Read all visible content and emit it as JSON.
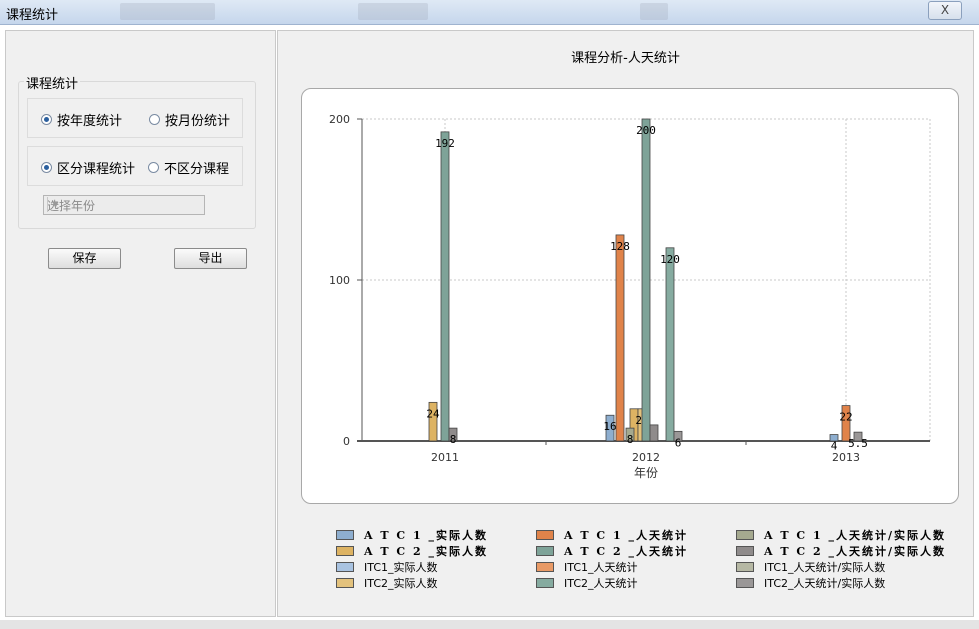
{
  "window": {
    "title": "课程统计",
    "close_label": "X"
  },
  "left": {
    "group_title": "课程统计",
    "radio_row1": [
      {
        "label": "按年度统计",
        "checked": true
      },
      {
        "label": "按月份统计",
        "checked": false
      }
    ],
    "radio_row2": [
      {
        "label": "区分课程统计",
        "checked": true
      },
      {
        "label": "不区分课程",
        "checked": false
      }
    ],
    "year_select": {
      "value": "选择年份"
    },
    "save_label": "保存",
    "export_label": "导出"
  },
  "chart_data": {
    "type": "bar",
    "title": "课程分析-人天统计",
    "xlabel": "年份",
    "ylabel": "",
    "categories": [
      "2011",
      "2012",
      "2013"
    ],
    "ylim": [
      0,
      200
    ],
    "yticks": [
      0,
      100,
      200
    ],
    "grid": true,
    "legend_position": "bottom",
    "series": [
      {
        "name": "A T C 1 _实际人数",
        "color": "#8eaecf",
        "values": [
          null,
          16,
          4
        ],
        "labels": [
          "",
          "16",
          "4"
        ]
      },
      {
        "name": "A T C 2 _实际人数",
        "color": "#ddb363",
        "values": [
          24,
          20,
          null
        ],
        "labels": [
          "24",
          "",
          ""
        ]
      },
      {
        "name": "ITC1_实际人数",
        "color": "#a9c3e1",
        "values": [
          null,
          null,
          null
        ],
        "labels": [
          "",
          "",
          ""
        ]
      },
      {
        "name": "ITC2_实际人数",
        "color": "#e3c27d",
        "values": [
          null,
          20,
          null
        ],
        "labels": [
          "",
          "20",
          ""
        ]
      },
      {
        "name": "A T C 1 _人天统计",
        "color": "#e0834a",
        "values": [
          null,
          128,
          22
        ],
        "labels": [
          "",
          "128",
          "22"
        ]
      },
      {
        "name": "A T C 2 _人天统计",
        "color": "#7ea398",
        "values": [
          192,
          200,
          null
        ],
        "labels": [
          "192",
          "200",
          ""
        ]
      },
      {
        "name": "ITC1_人天统计",
        "color": "#e99a66",
        "values": [
          null,
          null,
          null
        ],
        "labels": [
          "",
          "",
          ""
        ]
      },
      {
        "name": "ITC2_人天统计",
        "color": "#86aba0",
        "values": [
          null,
          120,
          null
        ],
        "labels": [
          "",
          "120",
          ""
        ]
      },
      {
        "name": "A T C 1 _人天统计/实际人数",
        "color": "#a5a98f",
        "values": [
          null,
          8,
          null
        ],
        "labels": [
          "",
          "8",
          ""
        ]
      },
      {
        "name": "A T C 2 _人天统计/实际人数",
        "color": "#8f8b8b",
        "values": [
          8,
          10,
          null
        ],
        "labels": [
          "8",
          "",
          ""
        ]
      },
      {
        "name": "ITC1_人天统计/实际人数",
        "color": "#b6b8a4",
        "values": [
          null,
          null,
          null
        ],
        "labels": [
          "",
          "",
          ""
        ]
      },
      {
        "name": "ITC2_人天统计/实际人数",
        "color": "#9a9797",
        "values": [
          null,
          6,
          5.5
        ],
        "labels": [
          "",
          "6",
          "5.5"
        ]
      }
    ]
  }
}
